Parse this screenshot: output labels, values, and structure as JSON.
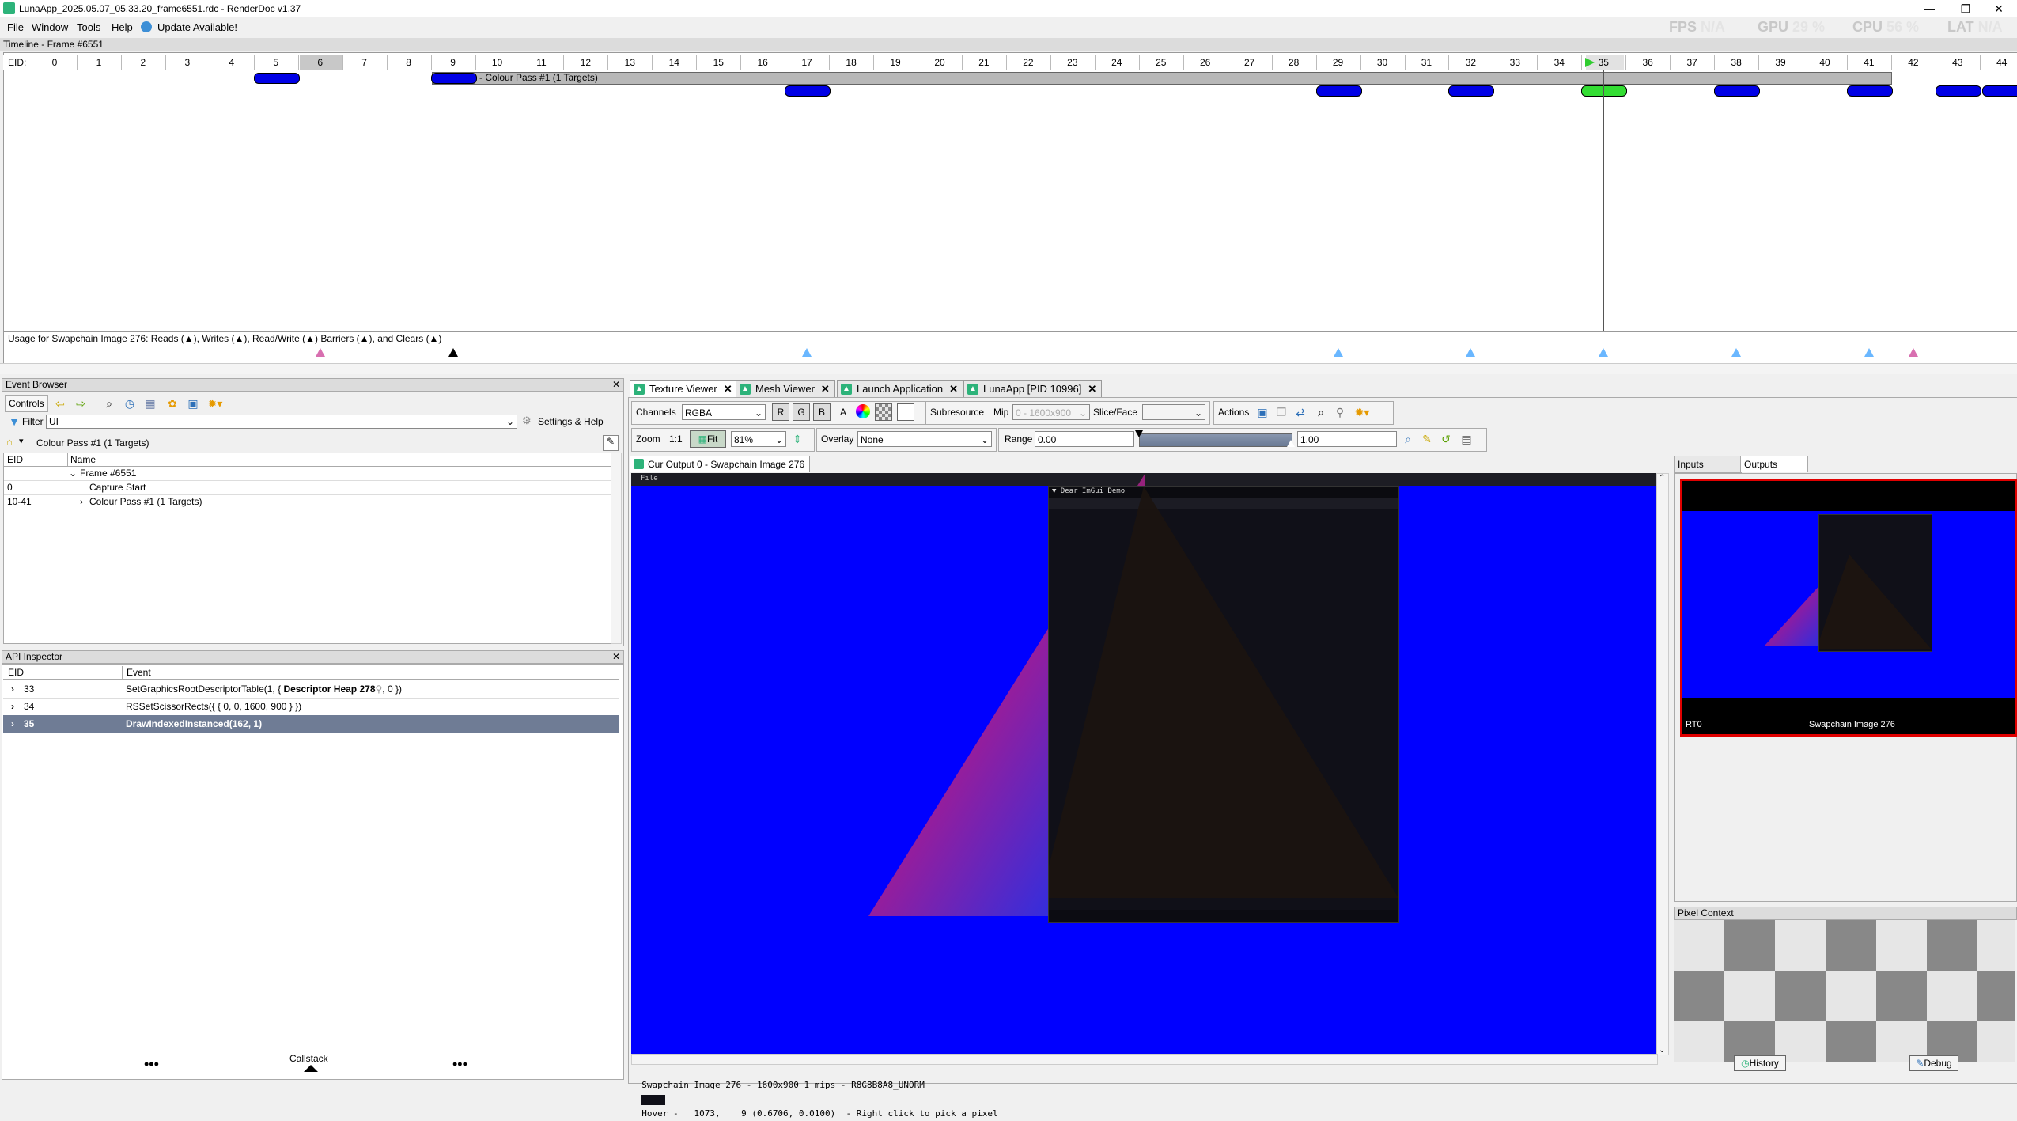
{
  "window": {
    "title": "LunaApp_2025.05.07_05.33.20_frame6551.rdc - RenderDoc v1.37",
    "minimize": "—",
    "maximize": "❐",
    "close": "✕"
  },
  "menu": {
    "file": "File",
    "window": "Window",
    "tools": "Tools",
    "help": "Help",
    "update": "Update Available!"
  },
  "perf": {
    "fps_label": "FPS",
    "fps_value": "N/A",
    "gpu_label": "GPU",
    "gpu_value": "29 %",
    "cpu_label": "CPU",
    "cpu_value": "56 %",
    "lat_label": "LAT",
    "lat_value": "N/A"
  },
  "timeline": {
    "title": "Timeline - Frame #6551",
    "eid_label": "EID:",
    "ticks": [
      "0",
      "1",
      "2",
      "3",
      "4",
      "5",
      "6",
      "7",
      "8",
      "9",
      "10",
      "11",
      "12",
      "13",
      "14",
      "15",
      "16",
      "17",
      "18",
      "19",
      "20",
      "21",
      "22",
      "23",
      "24",
      "25",
      "26",
      "27",
      "28",
      "29",
      "30",
      "31",
      "32",
      "33",
      "34",
      "35",
      "36",
      "37",
      "38",
      "39",
      "40",
      "41",
      "42",
      "43",
      "44"
    ],
    "pass_label": "Colour Pass #1 (1 Targets)",
    "usage_text": "Usage for Swapchain Image 276: Reads (▲), Writes (▲), Read/Write (▲) Barriers (▲), and Clears (▲)"
  },
  "event_browser": {
    "title": "Event Browser",
    "controls_label": "Controls",
    "filter_label": "Filter",
    "filter_value": "UI",
    "settings_label": "Settings & Help",
    "breadcrumb": "Colour Pass #1 (1 Targets)",
    "col_eid": "EID",
    "col_name": "Name",
    "rows": [
      {
        "eid": "",
        "name": "Frame #6551"
      },
      {
        "eid": "0",
        "name": "Capture Start"
      },
      {
        "eid": "10-41",
        "name": "Colour Pass #1 (1 Targets)"
      }
    ]
  },
  "api_inspector": {
    "title": "API Inspector",
    "col_eid": "EID",
    "col_event": "Event",
    "rows": [
      {
        "eid": "33",
        "event": "SetGraphicsRootDescriptorTable(1, {",
        "bold": "Descriptor Heap 278",
        "tail": ", 0 })"
      },
      {
        "eid": "34",
        "event": "RSSetScissorRects({ { 0, 0, 1600, 900 } })",
        "bold": "",
        "tail": ""
      },
      {
        "eid": "35",
        "event": "DrawIndexedInstanced(162, 1)",
        "bold": "",
        "tail": ""
      }
    ],
    "callstack": "Callstack"
  },
  "tabs": [
    {
      "label": "Texture Viewer"
    },
    {
      "label": "Mesh Viewer"
    },
    {
      "label": "Launch Application"
    },
    {
      "label": "LunaApp [PID 10996]"
    }
  ],
  "texture_viewer": {
    "channels_label": "Channels",
    "channels_value": "RGBA",
    "r": "R",
    "g": "G",
    "b": "B",
    "a": "A",
    "subresource_label": "Subresource",
    "mip_label": "Mip",
    "mip_value": "0 - 1600x900",
    "slice_label": "Slice/Face",
    "actions_label": "Actions",
    "zoom_label": "Zoom",
    "zoom_one": "1:1",
    "fit_label": "Fit",
    "zoom_value": "81%",
    "overlay_label": "Overlay",
    "overlay_value": "None",
    "range_label": "Range",
    "range_min": "0.00",
    "range_max": "1.00",
    "output_tab": "Cur Output 0 - Swapchain Image 276",
    "image_menu": "File",
    "imgui_title": "▼ Dear ImGui Demo",
    "status": "Swapchain Image 276 - 1600x900 1 mips - R8G8B8A8_UNORM",
    "status_hover": "Hover -   1073,    9 (0.6706, 0.0100)  - Right click to pick a pixel"
  },
  "side": {
    "inputs_tab": "Inputs",
    "outputs_tab": "Outputs",
    "thumb_slot": "RT0",
    "thumb_name": "Swapchain Image 276",
    "pixel_context": "Pixel Context",
    "history": "History",
    "debug": "Debug"
  },
  "colors": {
    "clear_blue": "#0000ff",
    "timeline_pill": "#0000e6",
    "current_pill": "#33dd33",
    "selected_row": "#6f7c95",
    "imgui_bg": "#101018"
  }
}
